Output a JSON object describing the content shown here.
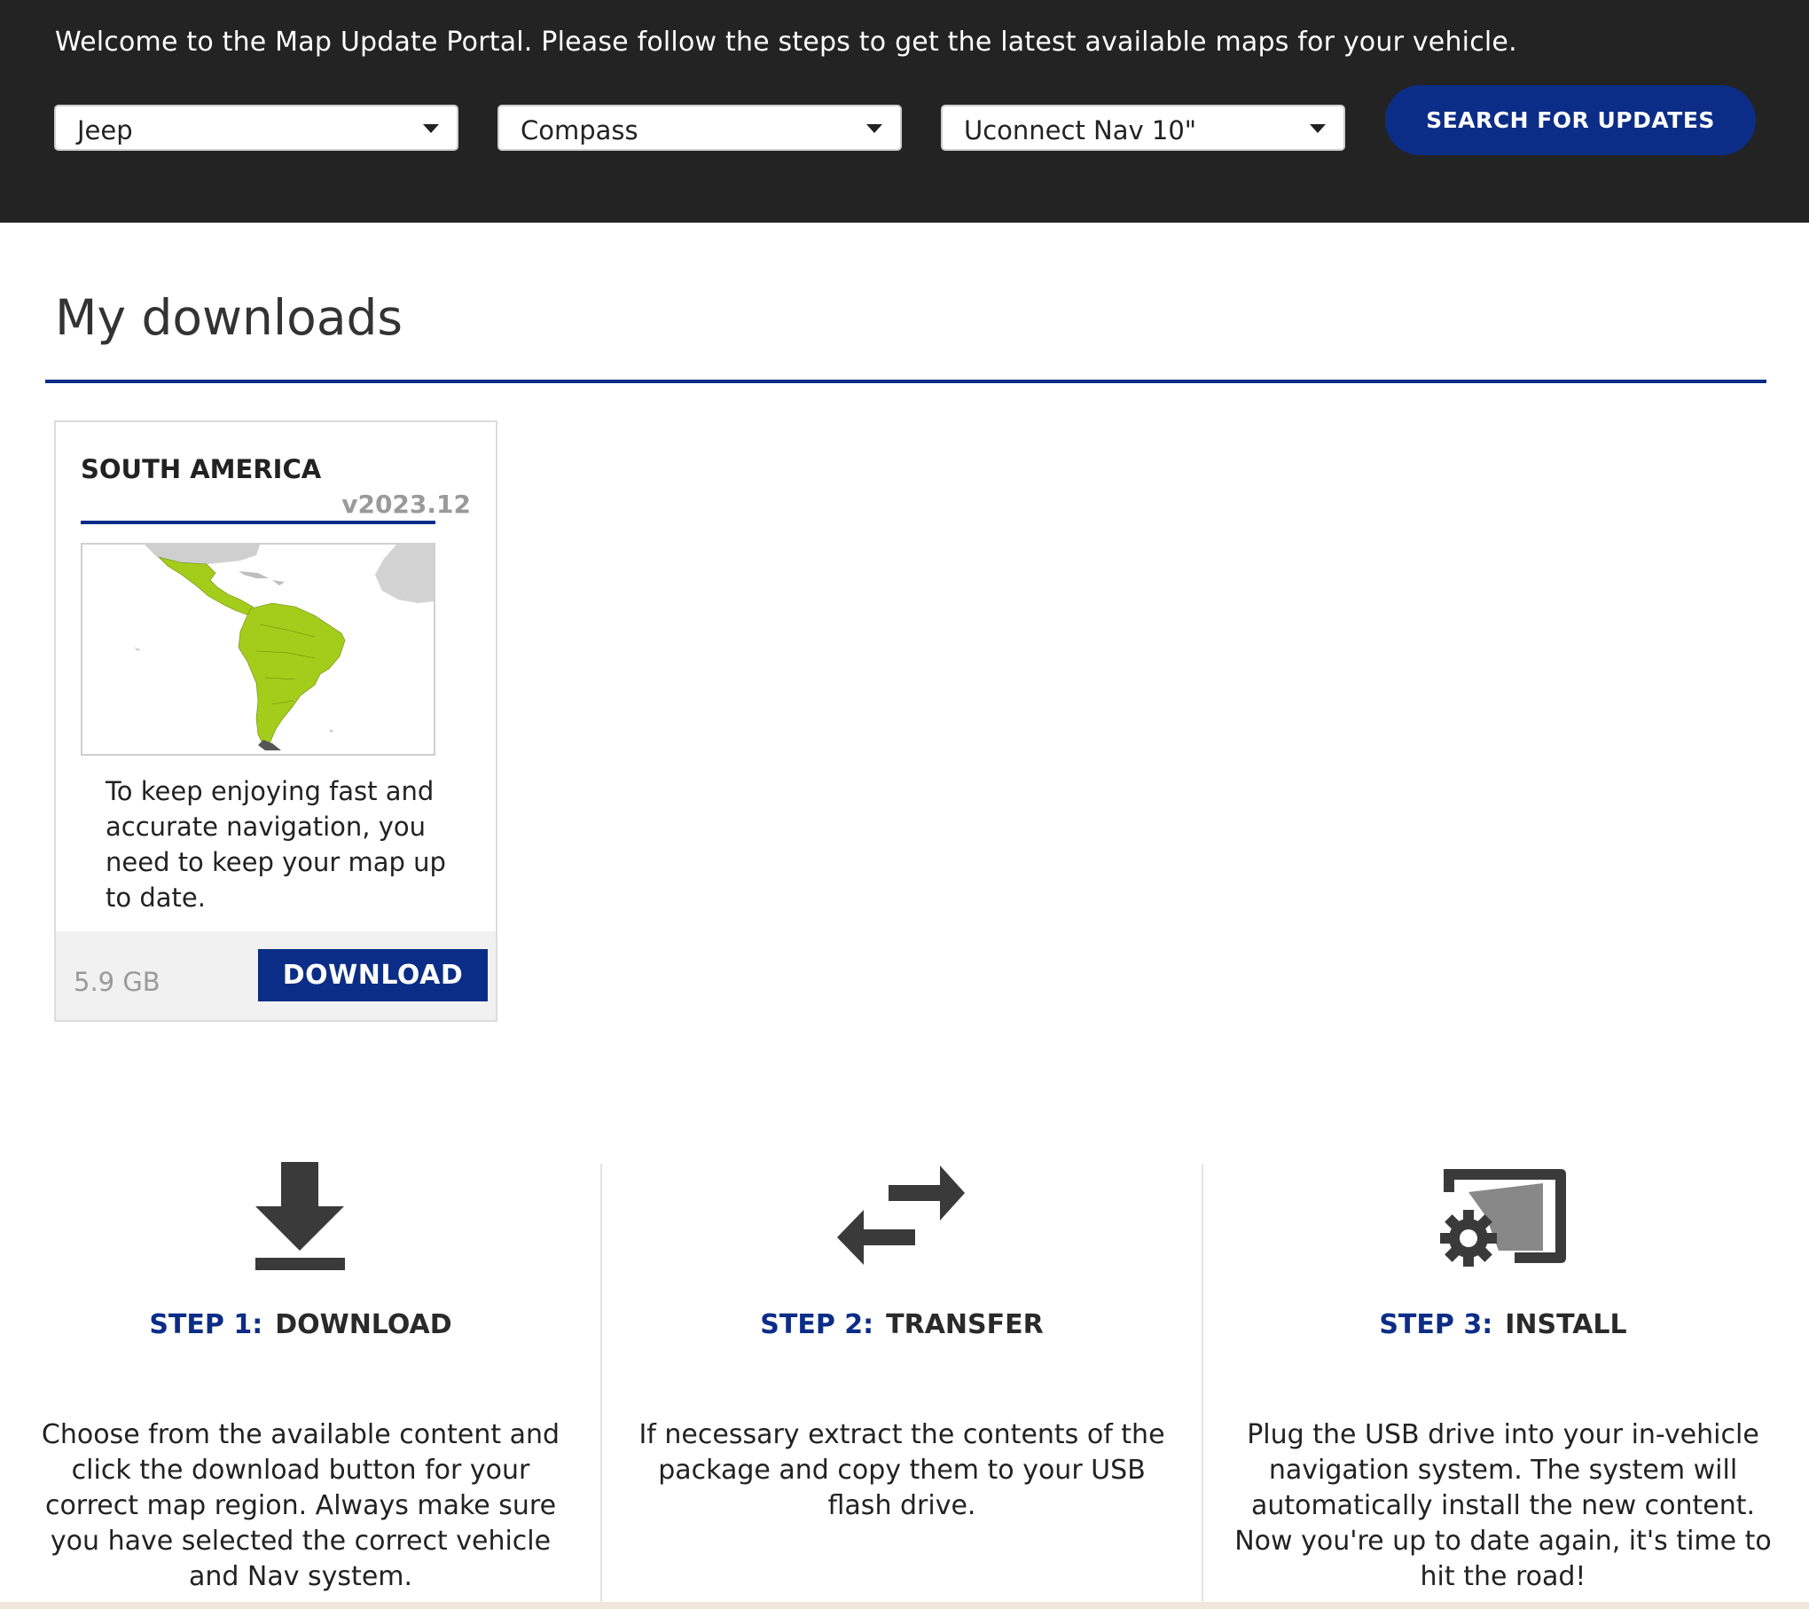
{
  "header": {
    "message": "Welcome to the Map Update Portal. Please follow the steps to get the latest available maps for your vehicle.",
    "brand_select": "Jeep",
    "model_select": "Compass",
    "nav_select": "Uconnect Nav 10\"",
    "search_label": "SEARCH FOR UPDATES"
  },
  "colors": {
    "header_bg": "#232323",
    "accent": "#0b2d87",
    "map_highlight": "#a4cc1a"
  },
  "main": {
    "title": "My downloads",
    "card": {
      "region": "SOUTH AMERICA",
      "version": "v2023.12",
      "description": "To keep enjoying fast and accurate navigation, you need to keep your map up to date.",
      "size": "5.9 GB",
      "download_label": "DOWNLOAD"
    }
  },
  "steps": [
    {
      "number": "STEP 1:",
      "name": "DOWNLOAD",
      "icon": "download-icon",
      "description": "Choose from the available content and click the download button for your correct map region. Always make sure you have selected the correct vehicle and Nav system."
    },
    {
      "number": "STEP 2:",
      "name": "TRANSFER",
      "icon": "transfer-arrows-icon",
      "description": "If necessary extract the contents of the package and copy them to your USB flash drive."
    },
    {
      "number": "STEP 3:",
      "name": "INSTALL",
      "icon": "install-screen-gear-icon",
      "description": "Plug the USB drive into your in-vehicle navigation system. The system will automatically install the new content. Now you're up to date again, it's time to hit the road!"
    }
  ]
}
